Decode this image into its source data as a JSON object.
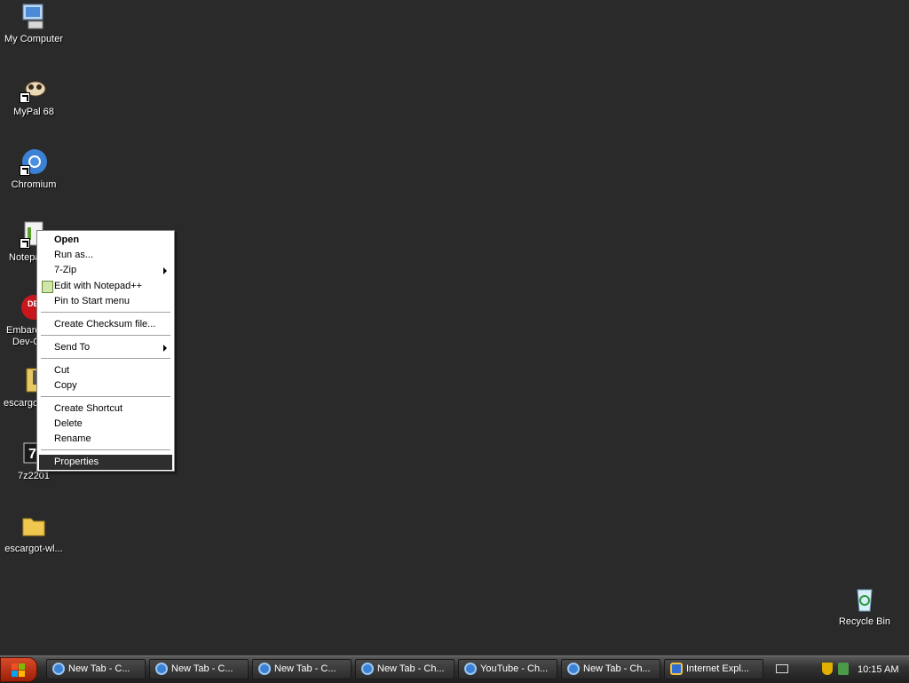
{
  "desktop": {
    "icons": [
      {
        "label": "My Computer",
        "icon": "my-computer-icon"
      },
      {
        "label": "MyPal 68",
        "icon": "mypal-icon"
      },
      {
        "label": "Chromium",
        "icon": "chromium-icon"
      },
      {
        "label": "Notepa",
        "icon": "notepad-icon"
      },
      {
        "label": "Embarc",
        "label2": "Dev-C",
        "icon": "embarcadero-dev-cpp-icon"
      },
      {
        "label": "escargot",
        "icon": "zip-archive-icon"
      },
      {
        "label": "7z2201",
        "icon": "seven-zip-installer-icon"
      },
      {
        "label": "escargot-wl...",
        "icon": "folder-icon"
      },
      {
        "label": "Recycle Bin",
        "icon": "recycle-bin-icon"
      }
    ]
  },
  "context_menu": {
    "items": [
      {
        "label": "Open",
        "bold": true
      },
      {
        "label": "Run as..."
      },
      {
        "label": "7-Zip",
        "submenu": true
      },
      {
        "label": "Edit with Notepad++",
        "icon": "notepad-plus-plus-icon"
      },
      {
        "label": "Pin to Start menu"
      },
      {
        "label": "Create Checksum file..."
      },
      {
        "label": "Send To",
        "submenu": true
      },
      {
        "label": "Cut"
      },
      {
        "label": "Copy"
      },
      {
        "label": "Create Shortcut"
      },
      {
        "label": "Delete"
      },
      {
        "label": "Rename"
      },
      {
        "label": "Properties",
        "selected": true
      }
    ]
  },
  "taskbar": {
    "start_icon": "windows-flag-icon",
    "buttons": [
      {
        "label": "New Tab - C...",
        "icon": "chromium-icon"
      },
      {
        "label": "New Tab - C...",
        "icon": "chromium-icon"
      },
      {
        "label": "New Tab - C...",
        "icon": "chromium-icon"
      },
      {
        "label": "New Tab - Ch...",
        "icon": "chromium-icon"
      },
      {
        "label": "YouTube - Ch...",
        "icon": "chromium-icon"
      },
      {
        "label": "New Tab - Ch...",
        "icon": "chromium-icon"
      },
      {
        "label": "Internet Expl...",
        "icon": "internet-explorer-icon"
      }
    ],
    "tray": {
      "clock": "10:15 AM",
      "icons": [
        "keyboard-icon",
        "security-shield-icon",
        "network-icon"
      ]
    }
  },
  "colors": {
    "desktop_background": "#2a2a2a",
    "menu_selection": "#2e2e2e",
    "start_button": "#c0381a"
  }
}
